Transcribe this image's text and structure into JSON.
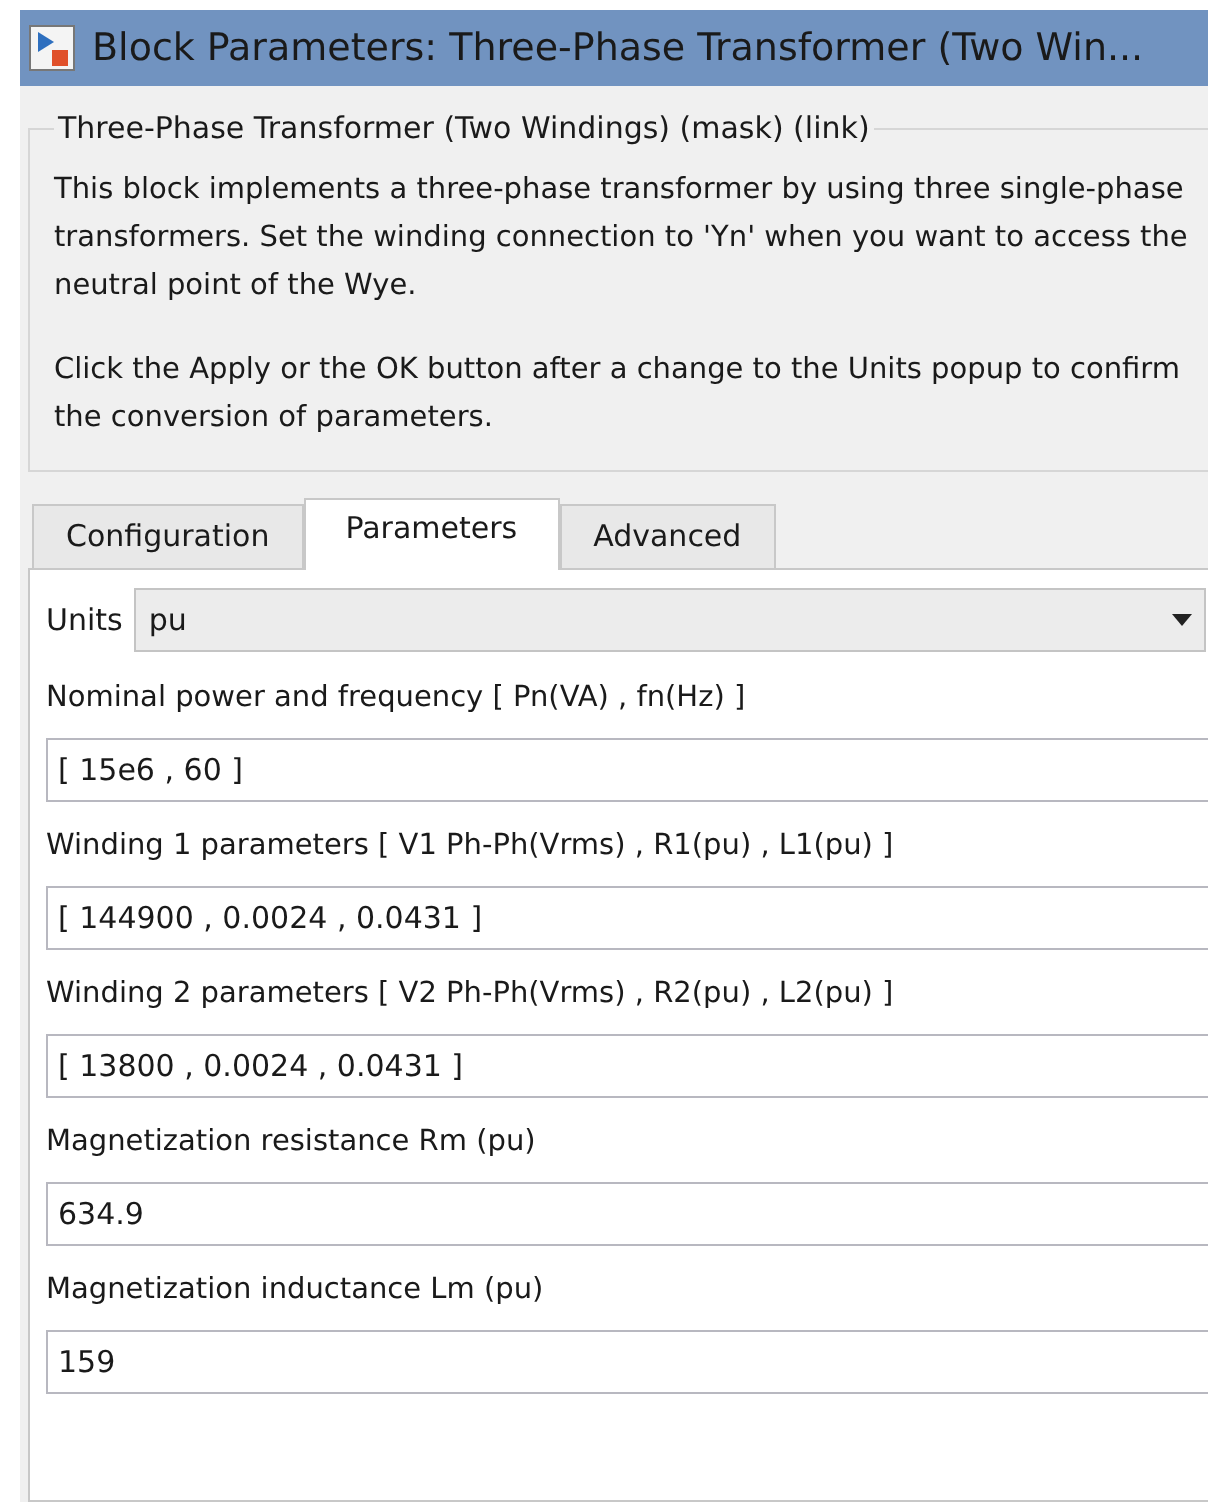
{
  "window": {
    "title": "Block Parameters: Three-Phase Transformer (Two Win..."
  },
  "group": {
    "title": "Three-Phase Transformer (Two Windings) (mask) (link)",
    "paragraphs": [
      "This block implements a three-phase transformer by using three single-phase transformers. Set the winding connection to 'Yn' when you want to access the neutral point of the Wye.",
      "Click the Apply or the OK button after a change to the Units popup to confirm the conversion of parameters."
    ]
  },
  "tabs": [
    {
      "label": "Configuration",
      "selected": false
    },
    {
      "label": "Parameters",
      "selected": true
    },
    {
      "label": "Advanced",
      "selected": false
    }
  ],
  "units": {
    "label": "Units",
    "value": "pu"
  },
  "fields": [
    {
      "label": "Nominal power and frequency  [ Pn(VA) , fn(Hz) ]",
      "value": "[ 15e6 , 60 ]"
    },
    {
      "label": "Winding 1 parameters [ V1 Ph-Ph(Vrms) , R1(pu) , L1(pu) ]",
      "value": "[ 144900 , 0.0024 , 0.0431 ]"
    },
    {
      "label": "Winding 2 parameters [ V2 Ph-Ph(Vrms) , R2(pu) , L2(pu) ]",
      "value": "[ 13800 , 0.0024 , 0.0431 ]"
    },
    {
      "label": "Magnetization resistance  Rm (pu)",
      "value": "634.9"
    },
    {
      "label": "Magnetization inductance  Lm (pu)",
      "value": "159"
    }
  ]
}
